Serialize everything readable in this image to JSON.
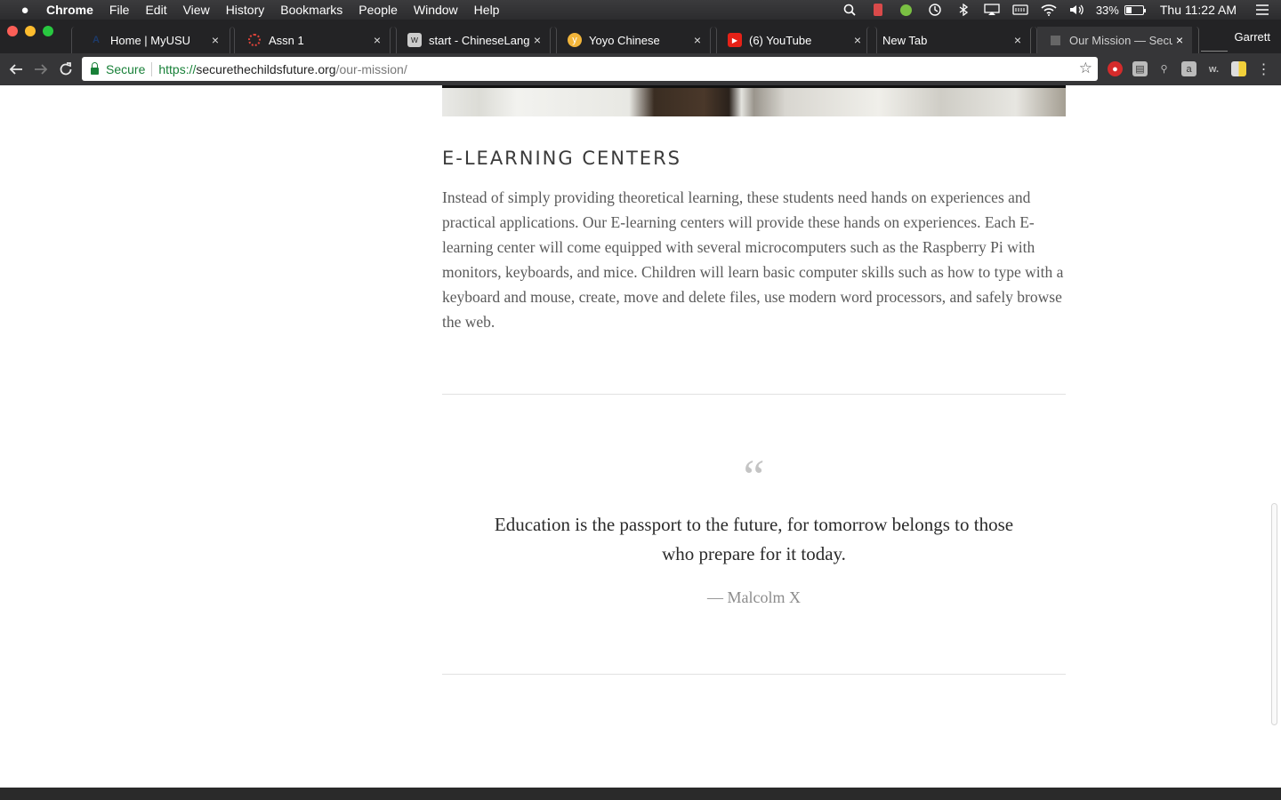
{
  "menubar": {
    "app_name": "Chrome",
    "items": [
      "File",
      "Edit",
      "View",
      "History",
      "Bookmarks",
      "People",
      "Window",
      "Help"
    ],
    "battery_percent": "33%",
    "battery_level": 0.33,
    "clock": "Thu 11:22 AM"
  },
  "tabs": [
    {
      "title": "Home | MyUSU",
      "icon": "usu-icon",
      "active": false
    },
    {
      "title": "Assn 1",
      "icon": "canvas-icon",
      "active": false
    },
    {
      "title": "start - ChineseLangua",
      "icon": "wiki-icon",
      "active": false
    },
    {
      "title": "Yoyo Chinese",
      "icon": "yoyo-icon",
      "active": false
    },
    {
      "title": "(6) YouTube",
      "icon": "youtube-icon",
      "active": false
    },
    {
      "title": "New Tab",
      "icon": "",
      "active": false
    },
    {
      "title": "Our Mission — Secure",
      "icon": "page-icon",
      "active": true
    }
  ],
  "profile_name": "Garrett",
  "address_bar": {
    "secure_label": "Secure",
    "url_scheme": "https://",
    "url_host": "securethechildsfuture.org",
    "url_path": "/our-mission/"
  },
  "content": {
    "heading": "E-LEARNING CENTERS",
    "body": "Instead of simply providing theoretical learning, these students need hands on experiences and practical applications. Our E-learning centers will provide these hands on experiences. Each E-learning center will come equipped with several microcomputers such as the Raspberry Pi with monitors, keyboards, and mice. Children will learn basic computer skills such as how to type with a keyboard and mouse, create, move and delete files, use modern word processors, and safely browse the web.",
    "quote_mark": "“",
    "quote": "Education is the passport to the future, for tomorrow belongs to those who prepare for it today.",
    "quote_author": "— Malcolm X"
  },
  "colors": {
    "secure_green": "#188038",
    "heading": "#3a3a3a",
    "body_text": "#5a5a5a",
    "footer": "#2a2a2a"
  }
}
